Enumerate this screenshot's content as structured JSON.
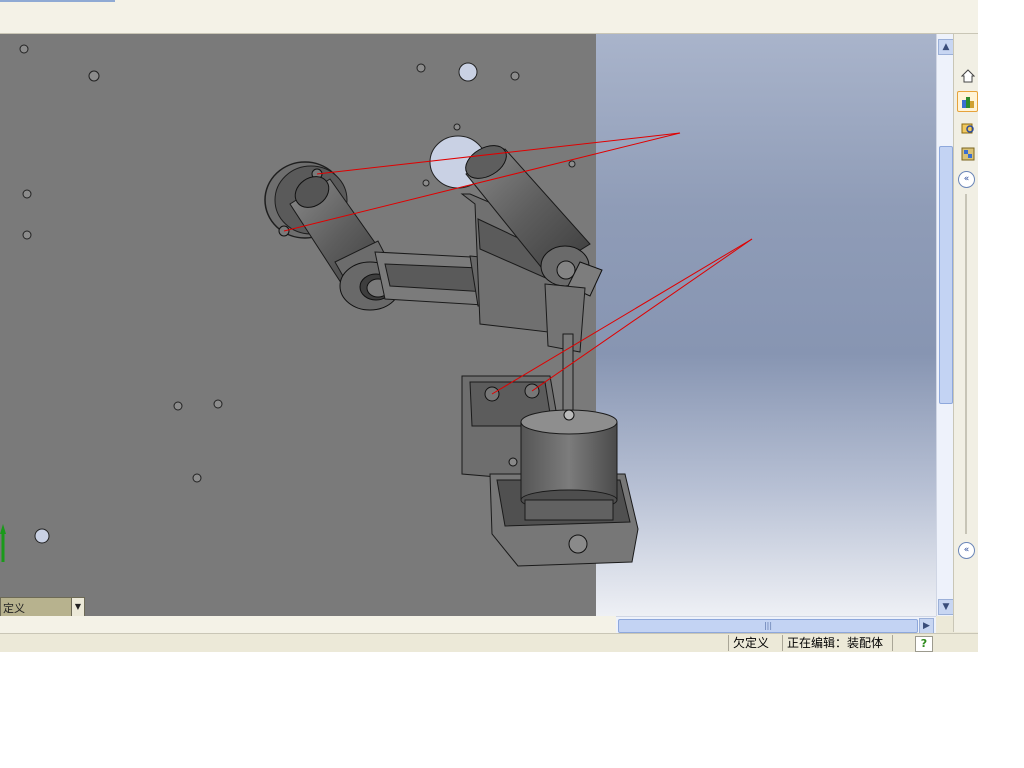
{
  "status": {
    "underdefined": "欠定义",
    "editing": "正在编辑：装配体",
    "help_glyph": "?"
  },
  "config_dropdown": {
    "value": "定义"
  },
  "taskpane": {
    "icons": [
      "home-icon",
      "design-library-icon",
      "file-explorer-icon",
      "view-palette-icon"
    ]
  },
  "scroll": {
    "h_thumb_grip": "|||"
  }
}
